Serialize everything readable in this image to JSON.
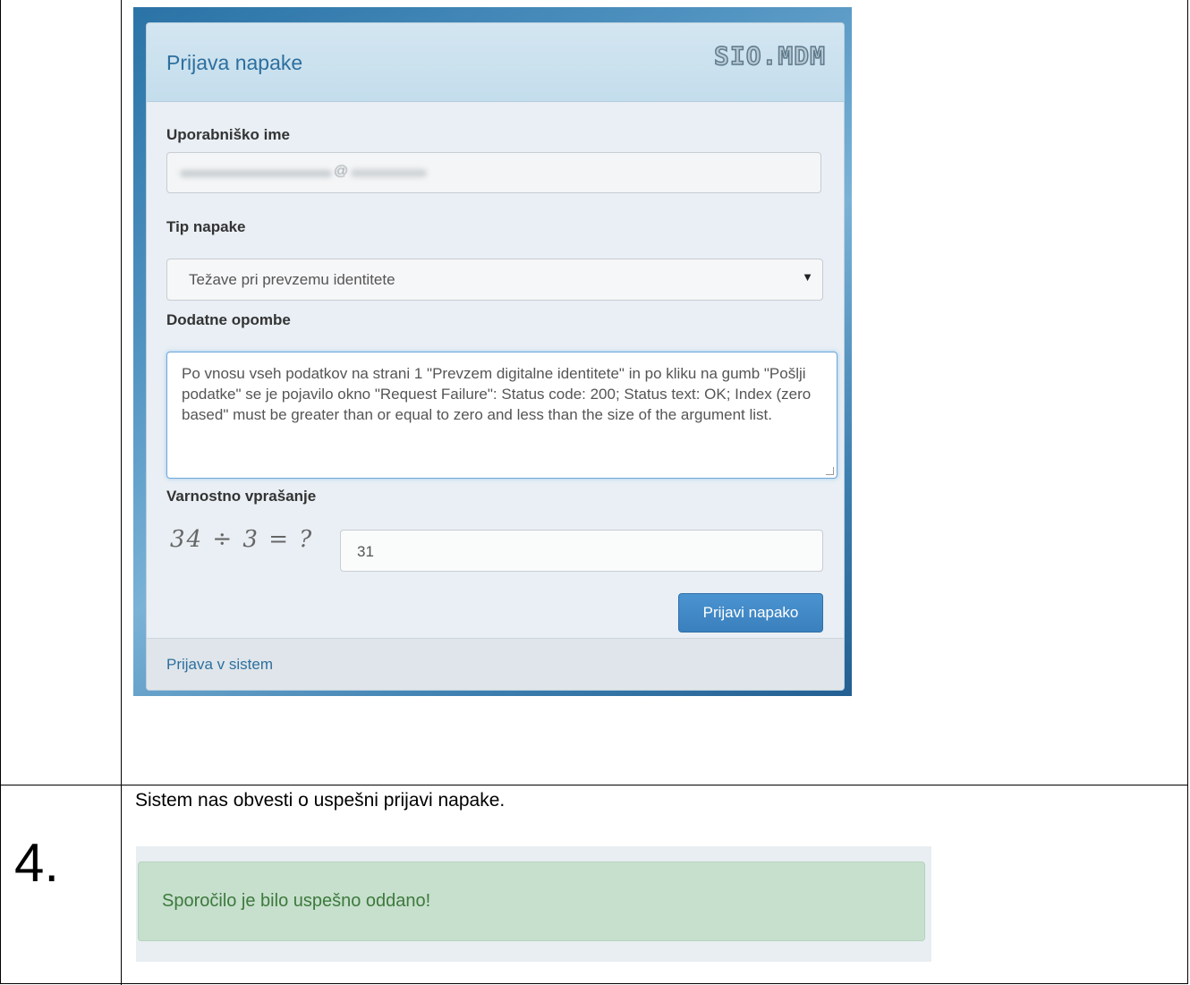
{
  "form": {
    "title": "Prijava napake",
    "logo": "SIO.MDM",
    "username_label": "Uporabniško ime",
    "username_value_visible": "@",
    "error_type_label": "Tip napake",
    "error_type_value": "Težave pri prevzemu identitete",
    "notes_label": "Dodatne opombe",
    "notes_value": "Po vnosu vseh podatkov na strani 1 \"Prevzem digitalne identitete\" in po kliku na gumb \"Pošlji podatke\" se je pojavilo okno \"Request Failure\": Status code: 200; Status text: OK; Index (zero based\" must be greater than or equal to zero and less than the size of the argument list.",
    "security_label": "Varnostno vprašanje",
    "captcha_text": "34 ÷ 3 = ?",
    "captcha_answer": "31",
    "submit_label": "Prijavi napako",
    "footer_link": "Prijava v sistem"
  },
  "step": {
    "number": "4.",
    "description": "Sistem nas obvesti o uspešni prijavi napake."
  },
  "alert": {
    "message": "Sporočilo je bilo uspešno oddano!"
  },
  "colors": {
    "title_blue": "#2d6f9f",
    "button_blue": "#3a80bd",
    "success_bg": "#c7dfcd",
    "success_text": "#3c7a3c"
  }
}
